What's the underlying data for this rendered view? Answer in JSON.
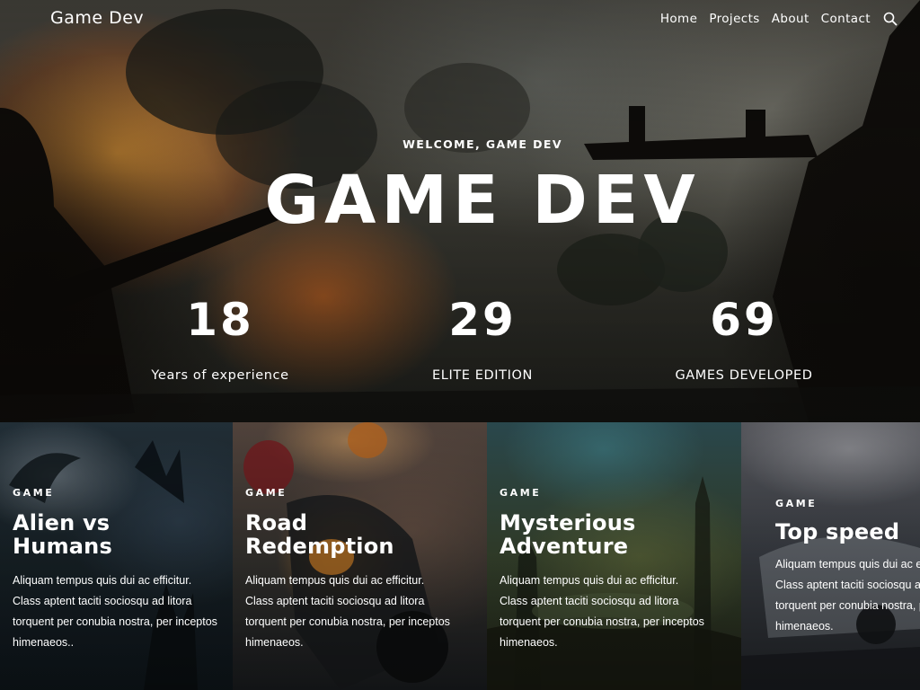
{
  "header": {
    "brand": "Game Dev",
    "nav": [
      "Home",
      "Projects",
      "About",
      "Contact"
    ],
    "search_icon": "search-icon"
  },
  "hero": {
    "welcome": "WELCOME, GAME DEV",
    "title": "GAME DEV",
    "stats": [
      {
        "value": "18",
        "label": "Years of experience"
      },
      {
        "value": "29",
        "label": "ELITE EDITION"
      },
      {
        "value": "69",
        "label": "GAMES DEVELOPED"
      }
    ]
  },
  "cards": [
    {
      "tag": "GAME",
      "title_line1": "Alien vs",
      "title_line2": "Humans",
      "desc": "Aliquam tempus quis dui ac efficitur. Class aptent taciti sociosqu ad litora torquent per conubia nostra, per inceptos himenaeos.."
    },
    {
      "tag": "GAME",
      "title_line1": "Road",
      "title_line2": "Redemption",
      "desc": "Aliquam tempus quis dui ac efficitur. Class aptent taciti sociosqu ad litora torquent per conubia nostra, per inceptos himenaeos."
    },
    {
      "tag": "GAME",
      "title_line1": "Mysterious",
      "title_line2": "Adventure",
      "desc": "Aliquam tempus quis dui ac efficitur. Class aptent taciti sociosqu ad litora torquent per conubia nostra, per inceptos himenaeos."
    },
    {
      "tag": "GAME",
      "title_line1": "Top speed",
      "title_line2": "",
      "desc": "Aliquam tempus quis dui ac efficitur. Class aptent taciti sociosqu ad litora torquent per conubia nostra, per inceptos himenaeos."
    }
  ]
}
